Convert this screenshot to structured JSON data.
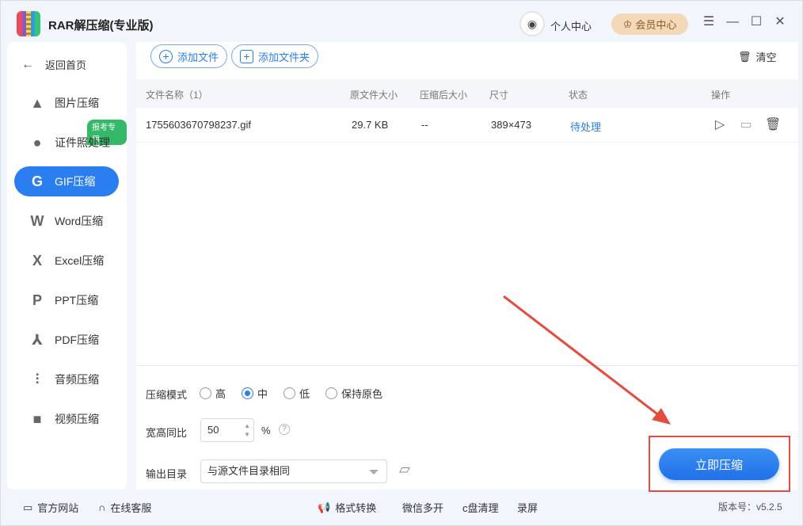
{
  "app": {
    "title": "RAR解压缩(专业版)",
    "user_center": "个人中心",
    "vip_label": "会员中心"
  },
  "sidebar": {
    "back": "返回首页",
    "badge": "报考专用",
    "items": [
      {
        "label": "图片压缩",
        "icon": "image-icon"
      },
      {
        "label": "证件照处理",
        "icon": "person-icon"
      },
      {
        "label": "GIF压缩",
        "icon": "gif-icon"
      },
      {
        "label": "Word压缩",
        "icon": "word-icon"
      },
      {
        "label": "Excel压缩",
        "icon": "excel-icon"
      },
      {
        "label": "PPT压缩",
        "icon": "ppt-icon"
      },
      {
        "label": "PDF压缩",
        "icon": "pdf-icon"
      },
      {
        "label": "音频压缩",
        "icon": "audio-icon"
      },
      {
        "label": "视频压缩",
        "icon": "video-icon"
      }
    ],
    "active": "GIF压缩"
  },
  "toolbar": {
    "add_file": "添加文件",
    "add_folder": "添加文件夹",
    "clear": "清空"
  },
  "table": {
    "headers": {
      "name": "文件名称（1）",
      "orig_size": "原文件大小",
      "comp_size": "压缩后大小",
      "dims": "尺寸",
      "status": "状态",
      "ops": "操作"
    },
    "rows": [
      {
        "name": "1755603670798237.gif",
        "orig_size": "29.7 KB",
        "comp_size": "--",
        "dims": "389×473",
        "status": "待处理"
      }
    ]
  },
  "settings": {
    "mode_label": "压缩模式",
    "modes": [
      "高",
      "中",
      "低",
      "保持原色"
    ],
    "mode_selected": "中",
    "ratio_label": "宽高同比",
    "ratio_value": "50",
    "ratio_unit": "%",
    "output_label": "输出目录",
    "output_value": "与源文件目录相同"
  },
  "action": {
    "compress": "立即压缩"
  },
  "footer": {
    "website": "官方网站",
    "service": "在线客服",
    "format": "格式转换",
    "wechat": "微信多开",
    "cdisk": "c盘清理",
    "record": "录屏",
    "version": "版本号：v5.2.5"
  },
  "colors": {
    "accent": "#2a7ef0",
    "badge": "#33b968",
    "vip": "#f3d9b8",
    "annotation": "#e34d3f"
  }
}
